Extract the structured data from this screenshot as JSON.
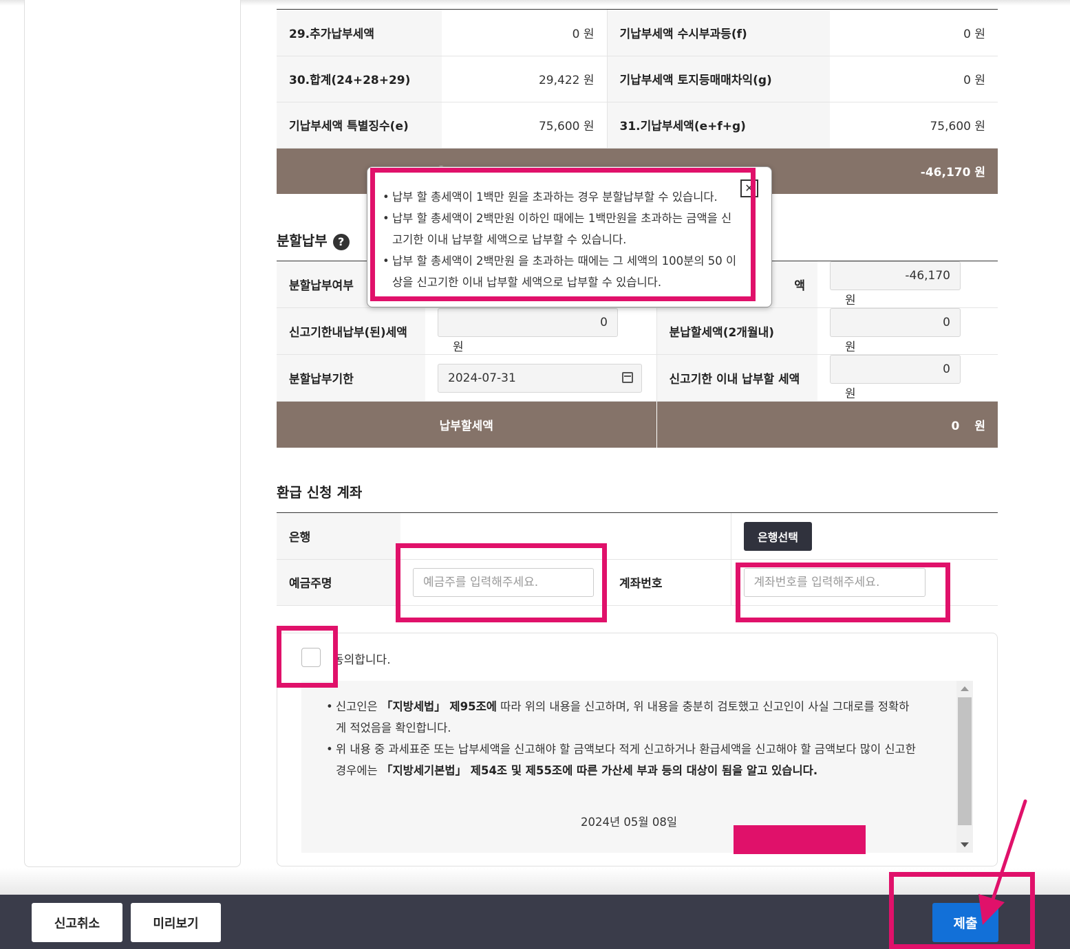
{
  "tax_summary": {
    "rows": [
      {
        "label_a": "29.추가납부세액",
        "value_a": "0 원",
        "label_b": "기납부세액 수시부과등(f)",
        "value_b": "0 원"
      },
      {
        "label_a": "30.합계(24+28+29)",
        "value_a": "29,422 원",
        "label_b": "기납부세액 토지등매매차익(g)",
        "value_b": "0 원"
      },
      {
        "label_a": "기납부세액 특별징수(e)",
        "value_a": "75,600 원",
        "label_b": "31.기납부세액(e+f+g)",
        "value_b": "75,600 원"
      }
    ],
    "total_label_partial": "3",
    "total_value": "-46,170 원"
  },
  "tooltip": {
    "items": [
      "납부 할 총세액이 1백만 원을 초과하는 경우 분할납부할 수 있습니다.",
      "납부 할 총세액이 2백만원 이하인 때에는 1백만원을 초과하는 금액을 신고기한 이내 납부할 세액으로 납부할 수 있습니다.",
      "납부 할 총세액이 2백만원 을 초과하는 때에는 그 세액의 100분의 50 이상을 신고기한 이내 납부할 세액으로 납부할 수 있습니다."
    ],
    "close_glyph": "✕"
  },
  "installment": {
    "title": "분할납부",
    "help_glyph": "?",
    "rows": [
      {
        "label_a": "분할납부여부",
        "label_b_partial": "액",
        "value_b": "-46,170",
        "unit": "원"
      },
      {
        "label_a": "신고기한내납부(된)세액",
        "value_a": "0",
        "label_b": "분납할세액(2개월내)",
        "value_b": "0",
        "unit": "원"
      },
      {
        "label_a": "분할납부기한",
        "value_a": "2024-07-31",
        "label_b": "신고기한 이내 납부할 세액",
        "value_b": "0",
        "unit": "원"
      }
    ],
    "total_label": "납부할세액",
    "total_value": "0",
    "total_unit": "원"
  },
  "refund": {
    "title": "환급 신청 계좌",
    "bank_label": "은행",
    "bank_button": "은행선택",
    "holder_label": "예금주명",
    "holder_placeholder": "예금주를 입력해주세요.",
    "account_label": "계좌번호",
    "account_placeholder": "계좌번호를 입력해주세요."
  },
  "agreement": {
    "label": "동의합니다.",
    "notice_1_pre": "신고인은 ",
    "notice_1_bold": "「지방세법」 제95조에",
    "notice_1_post": " 따라 위의 내용을 신고하며, 위 내용을 충분히 검토했고 신고인이 사실 그대로를 정확하게 적었음을 확인합니다.",
    "notice_2_pre": "위 내용 중 과세표준 또는 납부세액을 신고해야 할 금액보다 적게 신고하거나 환급세액을 신고해야 할 금액보다 많이 신고한 경우에는 ",
    "notice_2_bold": "「지방세기본법」 제54조 및 제55조에 따른 가산세 부과 등의 대상이 됨을 알고 있습니다.",
    "date": "2024년 05월 08일"
  },
  "footer": {
    "cancel_label": "신고취소",
    "preview_label": "미리보기",
    "submit_label": "제출"
  },
  "colors": {
    "highlight": "#e0116a",
    "total_row": "#857369",
    "submit": "#1270d8",
    "footer": "#3a3c4a"
  }
}
